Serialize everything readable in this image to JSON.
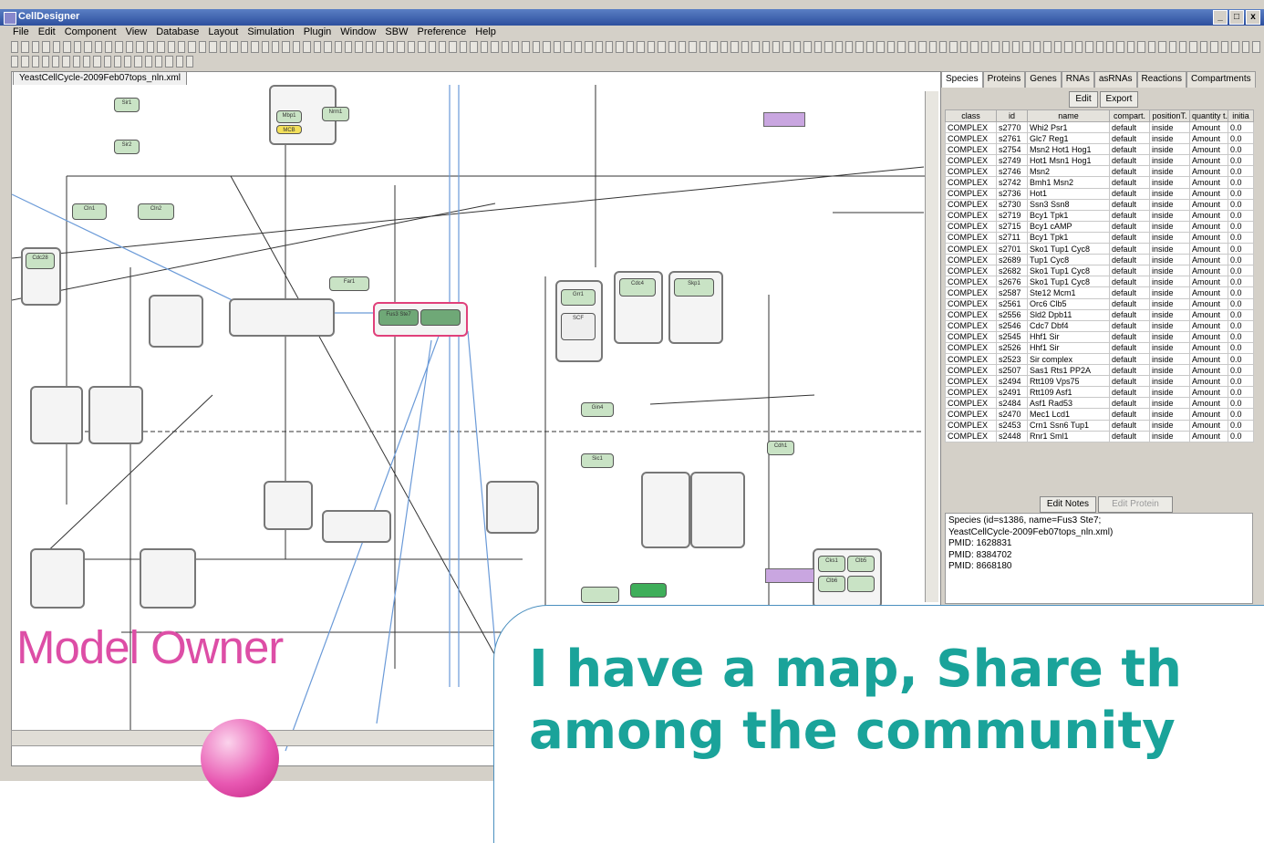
{
  "window": {
    "title": "CellDesigner",
    "controls": [
      "_",
      "□",
      "x"
    ]
  },
  "menu": [
    "File",
    "Edit",
    "Component",
    "View",
    "Database",
    "Layout",
    "Simulation",
    "Plugin",
    "Window",
    "SBW",
    "Preference",
    "Help"
  ],
  "doc_tab": "YeastCellCycle-2009Feb07tops_nln.xml",
  "nodes": [
    {
      "label": "Sir1"
    },
    {
      "label": "Sir2"
    },
    {
      "label": "Mbp1"
    },
    {
      "label": "MCB"
    },
    {
      "label": "Nrm1"
    },
    {
      "label": "Cln1"
    },
    {
      "label": "Cln2"
    },
    {
      "label": "Cdc28"
    },
    {
      "label": "Fus3 Ste7"
    },
    {
      "label": "Far1"
    },
    {
      "label": "Gin4"
    },
    {
      "label": "Skp1"
    },
    {
      "label": "Cdc4"
    },
    {
      "label": "Grr1"
    },
    {
      "label": "SCF"
    },
    {
      "label": "Cks1"
    },
    {
      "label": "Clb5"
    },
    {
      "label": "Clb6"
    },
    {
      "label": "Cdh1"
    },
    {
      "label": "Sic1"
    }
  ],
  "species_panel": {
    "tabs": [
      "Species",
      "Proteins",
      "Genes",
      "RNAs",
      "asRNAs",
      "Reactions",
      "Compartments"
    ],
    "buttons": {
      "edit": "Edit",
      "export": "Export"
    },
    "columns": [
      "class",
      "id",
      "name",
      "compart.",
      "positionT.",
      "quantity t.",
      "initia"
    ],
    "rows": [
      [
        "COMPLEX",
        "s2770",
        "Whi2 Psr1",
        "default",
        "inside",
        "Amount",
        "0.0"
      ],
      [
        "COMPLEX",
        "s2761",
        "Glc7 Reg1",
        "default",
        "inside",
        "Amount",
        "0.0"
      ],
      [
        "COMPLEX",
        "s2754",
        "Msn2 Hot1 Hog1",
        "default",
        "inside",
        "Amount",
        "0.0"
      ],
      [
        "COMPLEX",
        "s2749",
        "Hot1 Msn1 Hog1",
        "default",
        "inside",
        "Amount",
        "0.0"
      ],
      [
        "COMPLEX",
        "s2746",
        "Msn2",
        "default",
        "inside",
        "Amount",
        "0.0"
      ],
      [
        "COMPLEX",
        "s2742",
        "Bmh1 Msn2",
        "default",
        "inside",
        "Amount",
        "0.0"
      ],
      [
        "COMPLEX",
        "s2736",
        "Hot1",
        "default",
        "inside",
        "Amount",
        "0.0"
      ],
      [
        "COMPLEX",
        "s2730",
        "Ssn3 Ssn8",
        "default",
        "inside",
        "Amount",
        "0.0"
      ],
      [
        "COMPLEX",
        "s2719",
        "Bcy1 Tpk1",
        "default",
        "inside",
        "Amount",
        "0.0"
      ],
      [
        "COMPLEX",
        "s2715",
        "Bcy1 cAMP",
        "default",
        "inside",
        "Amount",
        "0.0"
      ],
      [
        "COMPLEX",
        "s2711",
        "Bcy1 Tpk1",
        "default",
        "inside",
        "Amount",
        "0.0"
      ],
      [
        "COMPLEX",
        "s2701",
        "Sko1 Tup1 Cyc8",
        "default",
        "inside",
        "Amount",
        "0.0"
      ],
      [
        "COMPLEX",
        "s2689",
        "Tup1 Cyc8",
        "default",
        "inside",
        "Amount",
        "0.0"
      ],
      [
        "COMPLEX",
        "s2682",
        "Sko1 Tup1 Cyc8",
        "default",
        "inside",
        "Amount",
        "0.0"
      ],
      [
        "COMPLEX",
        "s2676",
        "Sko1 Tup1 Cyc8",
        "default",
        "inside",
        "Amount",
        "0.0"
      ],
      [
        "COMPLEX",
        "s2587",
        "Ste12 Mcm1",
        "default",
        "inside",
        "Amount",
        "0.0"
      ],
      [
        "COMPLEX",
        "s2561",
        "Orc6 Clb5",
        "default",
        "inside",
        "Amount",
        "0.0"
      ],
      [
        "COMPLEX",
        "s2556",
        "Sld2 Dpb11",
        "default",
        "inside",
        "Amount",
        "0.0"
      ],
      [
        "COMPLEX",
        "s2546",
        "Cdc7 Dbf4",
        "default",
        "inside",
        "Amount",
        "0.0"
      ],
      [
        "COMPLEX",
        "s2545",
        "Hhf1 Sir",
        "default",
        "inside",
        "Amount",
        "0.0"
      ],
      [
        "COMPLEX",
        "s2526",
        "Hhf1 Sir",
        "default",
        "inside",
        "Amount",
        "0.0"
      ],
      [
        "COMPLEX",
        "s2523",
        "Sir complex",
        "default",
        "inside",
        "Amount",
        "0.0"
      ],
      [
        "COMPLEX",
        "s2507",
        "Sas1 Rts1 PP2A",
        "default",
        "inside",
        "Amount",
        "0.0"
      ],
      [
        "COMPLEX",
        "s2494",
        "Rtt109 Vps75",
        "default",
        "inside",
        "Amount",
        "0.0"
      ],
      [
        "COMPLEX",
        "s2491",
        "Rtt109 Asf1",
        "default",
        "inside",
        "Amount",
        "0.0"
      ],
      [
        "COMPLEX",
        "s2484",
        "Asf1 Rad53",
        "default",
        "inside",
        "Amount",
        "0.0"
      ],
      [
        "COMPLEX",
        "s2470",
        "Mec1 Lcd1",
        "default",
        "inside",
        "Amount",
        "0.0"
      ],
      [
        "COMPLEX",
        "s2453",
        "Crn1 Ssn6 Tup1",
        "default",
        "inside",
        "Amount",
        "0.0"
      ],
      [
        "COMPLEX",
        "s2448",
        "Rnr1 Sml1",
        "default",
        "inside",
        "Amount",
        "0.0"
      ]
    ],
    "notes_buttons": {
      "edit_notes": "Edit Notes",
      "edit_protein_notes": "Edit Protein Notes"
    },
    "notes_lines": [
      "Species (id=s1386, name=Fus3 Ste7;",
      "YeastCellCycle-2009Feb07tops_nln.xml)",
      "PMID: 1628831",
      "PMID: 8384702",
      "PMID: 8668180"
    ]
  },
  "overlay": {
    "role_title": "Model Owner",
    "message_line1": "I have a map, Share th",
    "message_line2": "among the community"
  },
  "colors": {
    "role_title": "#dd4ea6",
    "message": "#1aa39a",
    "node_fill": "#c9e3c5",
    "selection": "#e0407a"
  }
}
